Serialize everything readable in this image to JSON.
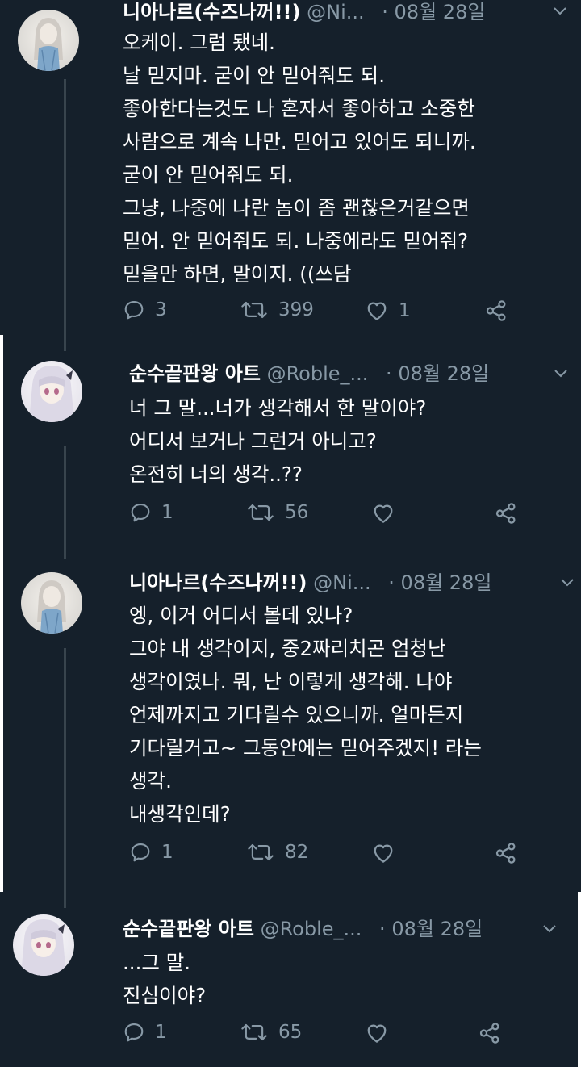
{
  "colors": {
    "background": "#15202b",
    "text": "#ffffff",
    "muted": "#8899a6",
    "thread_line": "#38444d"
  },
  "tweets": [
    {
      "name": "니아나르(수즈나꺼!!)",
      "handle": "@Ni...",
      "dot": "·",
      "date": "08월 28일",
      "lines": [
        "오케이. 그럼 됐네.",
        "날 믿지마. 굳이 안 믿어줘도 되.",
        "좋아한다는것도 나 혼자서 좋아하고 소중한",
        "사람으로 계속 나만. 믿어고 있어도 되니까.",
        "굳이 안 믿어줘도 되.",
        "그냥, 나중에 나란 놈이 좀 괜찮은거같으면",
        "믿어. 안 믿어줘도 되. 나중에라도 믿어줘?",
        "믿을만 하면, 말이지. ((쓰담"
      ],
      "replies": "3",
      "retweets": "399",
      "likes": "1"
    },
    {
      "name": "순수끝판왕 아트",
      "handle": "@Roble_...",
      "dot": "·",
      "date": "08월 28일",
      "lines": [
        "너 그 말...너가 생각해서 한 말이야?",
        "어디서 보거나 그런거 아니고?",
        "온전히 너의 생각..??"
      ],
      "replies": "1",
      "retweets": "56",
      "likes": ""
    },
    {
      "name": "니아나르(수즈나꺼!!)",
      "handle": "@Ni...",
      "dot": "·",
      "date": "08월 28일",
      "lines": [
        "엥, 이거 어디서 볼데 있나?",
        "그야 내 생각이지, 중2짜리치곤 엄청난",
        "생각이였나. 뭐, 난 이렇게 생각해. 나야",
        "언제까지고 기다릴수 있으니까. 얼마든지",
        "기다릴거고~ 그동안에는 믿어주겠지! 라는",
        "생각.",
        "내생각인데?"
      ],
      "replies": "1",
      "retweets": "82",
      "likes": ""
    },
    {
      "name": "순수끝판왕 아트",
      "handle": "@Roble_...",
      "dot": "·",
      "date": "08월 28일",
      "lines": [
        "...그 말.",
        "진심이야?"
      ],
      "replies": "1",
      "retweets": "65",
      "likes": ""
    }
  ]
}
